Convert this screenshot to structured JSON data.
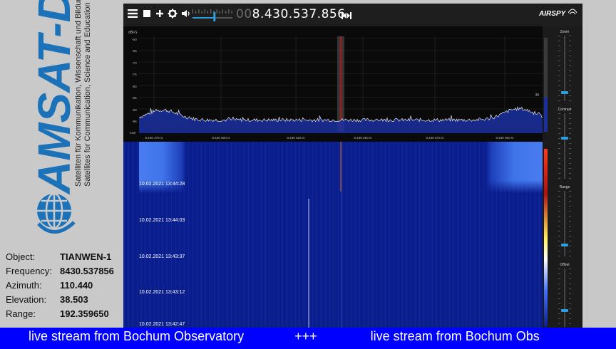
{
  "logo": {
    "brand": "AMSAT-DL",
    "tagline_de": "Satelliten für Kommunikation, Wissenschaft und Bildung",
    "tagline_en": "Satellites for Communication, Science and Education"
  },
  "info": [
    {
      "label": "Object:",
      "value": "TIANWEN-1"
    },
    {
      "label": "Frequency:",
      "value": "8430.537856"
    },
    {
      "label": "Azimuth:",
      "value": "110.440"
    },
    {
      "label": "Elevation:",
      "value": "38.503"
    },
    {
      "label": "Range:",
      "value": "192.359650"
    }
  ],
  "toolbar": {
    "menu_icon": "hamburger-icon",
    "stop_icon": "stop-icon",
    "add_icon": "plus-icon",
    "settings_icon": "gear-icon",
    "volume_icon": "speaker-icon",
    "volume_level": 0.55,
    "frequency_prefix": "00",
    "frequency": "8.430.537.856",
    "brand": "AIRSPY"
  },
  "spectrum": {
    "y_unit": "dBFS",
    "y_ticks": [
      "-50",
      "-55",
      "-70",
      "-75",
      "-80",
      "-85",
      "-90",
      "-95",
      "-100"
    ],
    "x_ticks": [
      "8,430 475 G",
      "8,430 500 G",
      "8,430 525 G",
      "8,430 550 G",
      "8,430 575 G",
      "8,430 600 G"
    ],
    "level_marker": "39"
  },
  "waterfall": {
    "timestamps": [
      "10.02.2021 13:44:28",
      "10.02.2021 13:44:03",
      "10.02.2021 13:43:37",
      "10.02.2021 13:43:12",
      "10.02.2021 13:42:47"
    ]
  },
  "sidebar": {
    "zoom_label": "Zoom",
    "contrast_label": "Contrast",
    "range_label": "Range",
    "offset_label": "Offset"
  },
  "ticker": {
    "text1": "live stream from Bochum Observatory",
    "separator": "+++",
    "text2": "live stream from Bochum Obs"
  },
  "colors": {
    "ticker_bg": "#0000ff",
    "waterfall_bg": "#0b1e8e",
    "panel_bg": "#c9c9c9",
    "logo_blue": "#1b72b8",
    "slider_accent": "#2aa0e0"
  }
}
